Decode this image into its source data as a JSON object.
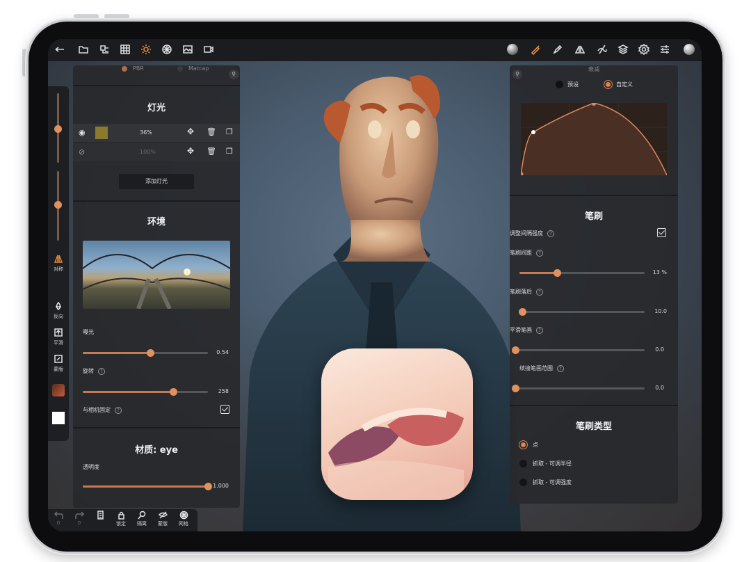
{
  "left_panel": {
    "render_modes": [
      "PBR",
      "Matcap"
    ],
    "lights_title": "灯光",
    "lights": [
      {
        "intensity": "36%",
        "visible": true,
        "color": "#8a7a2c"
      },
      {
        "intensity": "100%",
        "visible": false,
        "color": ""
      }
    ],
    "add_light_label": "添加灯光",
    "environment_title": "环境",
    "exposure_label": "曝光",
    "exposure_value": "0.54",
    "exposure_level": 0.54,
    "rotation_label": "旋转",
    "rotation_value": "258",
    "rotation_level": 0.72,
    "camera_fixed_label": "与相机固定",
    "camera_fixed_checked": true,
    "material_title": "材质: eye",
    "opacity_label": "透明度",
    "opacity_value": "1.000",
    "opacity_level": 1.0
  },
  "left_strip": {
    "symmetry_label": "对称",
    "invert_label": "反向",
    "smooth_label": "平滑",
    "mask_label": "蒙版",
    "radius_level": 0.55,
    "strength_level": 0.5
  },
  "right_panel": {
    "falloff_title": "衰减",
    "preset_label": "预设",
    "custom_label": "自定义",
    "brush_title": "笔刷",
    "adjust_spacing_label": "调整间隔强度",
    "adjust_spacing_checked": true,
    "spacing_label": "笔刷间距",
    "spacing_value": "13 %",
    "spacing_level": 0.3,
    "lag_label": "笔刷落后",
    "lag_value": "10.0",
    "lag_level": 0.02,
    "smooth_stroke_label": "平滑笔画",
    "smooth_stroke_value": "0.0",
    "continue_label": "续接笔画范围",
    "continue_value": "0.0",
    "brush_type_title": "笔刷类型",
    "brush_types": [
      "点",
      "抓取 - 可调半径",
      "抓取 - 可调强度"
    ],
    "selected_brush_type": 0
  },
  "bottom_bar": {
    "undo_count": "0",
    "redo_count": "0",
    "items": [
      "锁定",
      "隔离",
      "蒙版",
      "网格"
    ]
  },
  "colors": {
    "accent": "#e0915e",
    "panel": "#28292c",
    "toolbar": "#1b1c1f"
  }
}
